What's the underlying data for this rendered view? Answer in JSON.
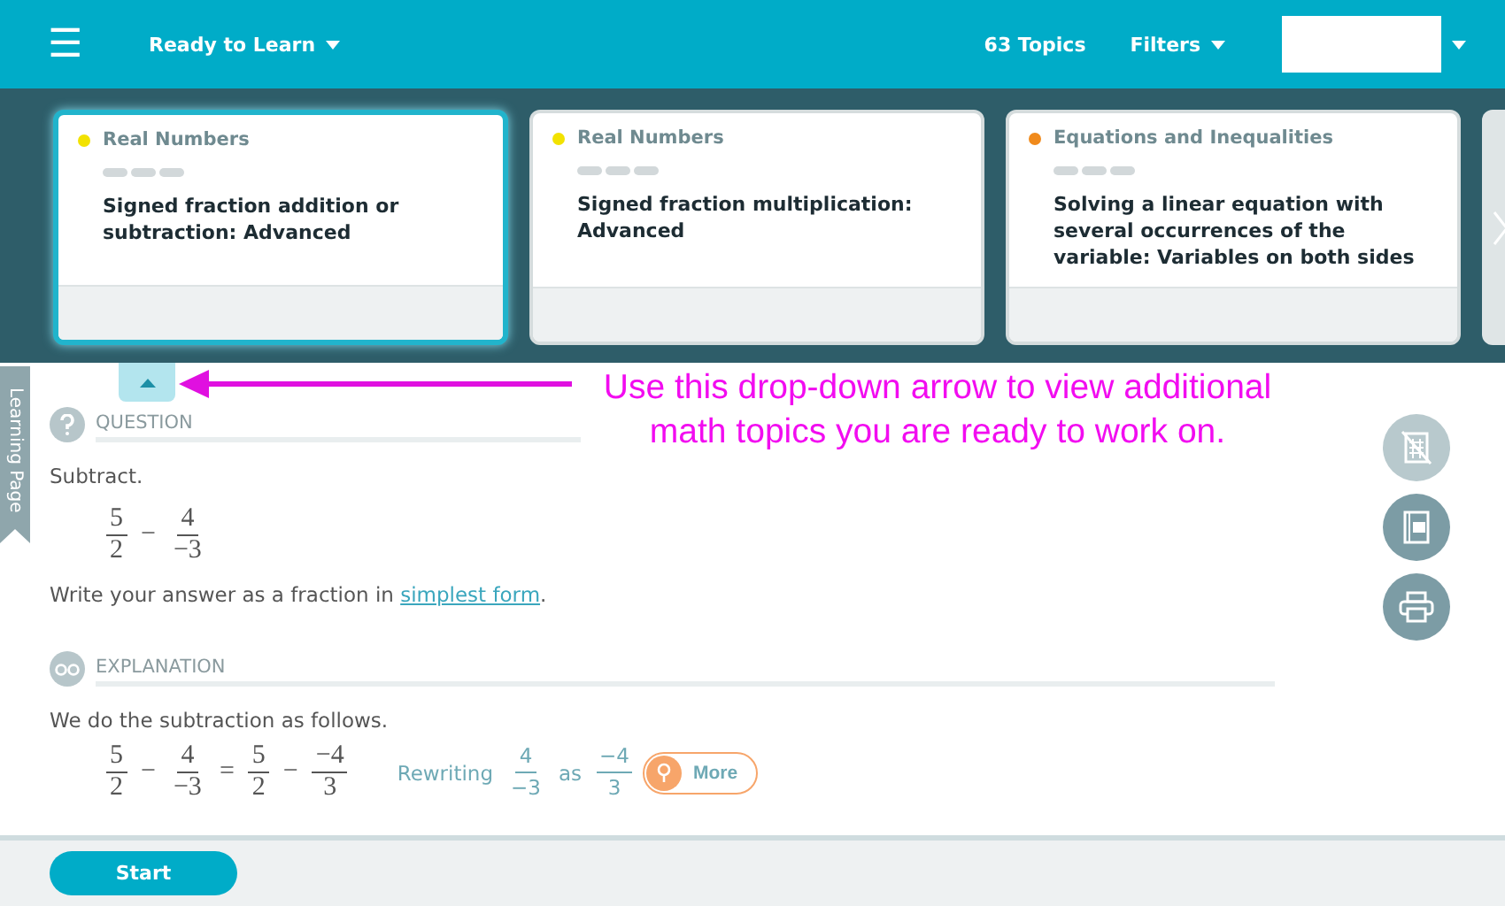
{
  "header": {
    "menu_label": "☰",
    "mode": "Ready to Learn",
    "topics_count": "63 Topics",
    "filters": "Filters"
  },
  "topic_cards": [
    {
      "category": "Real Numbers",
      "color": "#f2e200",
      "title": "Signed fraction addition or subtraction: Advanced",
      "selected": true
    },
    {
      "category": "Real Numbers",
      "color": "#f2e200",
      "title": "Signed fraction multiplication: Advanced",
      "selected": false
    },
    {
      "category": "Equations and Inequalities",
      "color": "#f08a1c",
      "title": "Solving a linear equation with several occurrences of the variable: Variables on both sides",
      "selected": false
    }
  ],
  "side_tab": "Learning Page",
  "annotation": "Use this drop-down arrow to view additional math topics you are ready to work on.",
  "question": {
    "heading": "QUESTION",
    "prompt": "Subtract.",
    "expression": [
      {
        "kind": "fraction",
        "num": "5",
        "den": "2"
      },
      {
        "kind": "op",
        "text": "−"
      },
      {
        "kind": "fraction",
        "num": "4",
        "den": "−3"
      }
    ],
    "instruction_before": "Write your answer as a fraction in ",
    "link": "simplest form",
    "instruction_after": "."
  },
  "explanation": {
    "heading": "EXPLANATION",
    "intro": "We do the subtraction as follows.",
    "expression": [
      {
        "kind": "fraction",
        "num": "5",
        "den": "2"
      },
      {
        "kind": "op",
        "text": "−"
      },
      {
        "kind": "fraction",
        "num": "4",
        "den": "−3"
      },
      {
        "kind": "op",
        "text": "="
      },
      {
        "kind": "fraction",
        "num": "5",
        "den": "2"
      },
      {
        "kind": "op",
        "text": "−"
      },
      {
        "kind": "fraction",
        "num": "−4",
        "den": "3"
      }
    ],
    "note": [
      {
        "kind": "text",
        "text": "Rewriting"
      },
      {
        "kind": "fraction",
        "num": "4",
        "den": "−3"
      },
      {
        "kind": "text",
        "text": "as"
      },
      {
        "kind": "fraction",
        "num": "−4",
        "den": "3"
      }
    ],
    "more": "More"
  },
  "tools": [
    {
      "kind": "calculator",
      "disabled": true
    },
    {
      "kind": "dictionary",
      "disabled": false
    },
    {
      "kind": "print",
      "disabled": false
    }
  ],
  "footer": {
    "button": "Start"
  }
}
